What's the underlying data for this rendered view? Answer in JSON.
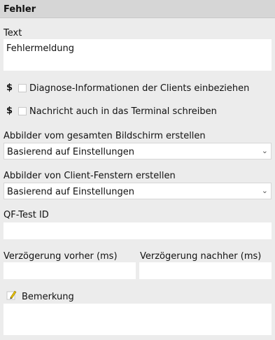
{
  "section_title": "Fehler",
  "text_label": "Text",
  "text_value": "Fehlermeldung",
  "dollar_symbol": "$",
  "check_diagnose_label": "Diagnose-Informationen der Clients einbeziehen",
  "check_terminal_label": "Nachricht auch in das Terminal schreiben",
  "screenshot_full_label": "Abbilder vom gesamten Bildschirm erstellen",
  "screenshot_full_value": "Basierend auf Einstellungen",
  "screenshot_client_label": "Abbilder von Client-Fenstern erstellen",
  "screenshot_client_value": "Basierend auf Einstellungen",
  "qftest_id_label": "QF-Test ID",
  "delay_before_label": "Verzögerung vorher (ms)",
  "delay_after_label": "Verzögerung nachher (ms)",
  "comment_label": "Bemerkung",
  "icons": {
    "checkbox": "checkbox-icon",
    "dropdown": "chevron-down-icon",
    "comment": "pencil-icon"
  }
}
